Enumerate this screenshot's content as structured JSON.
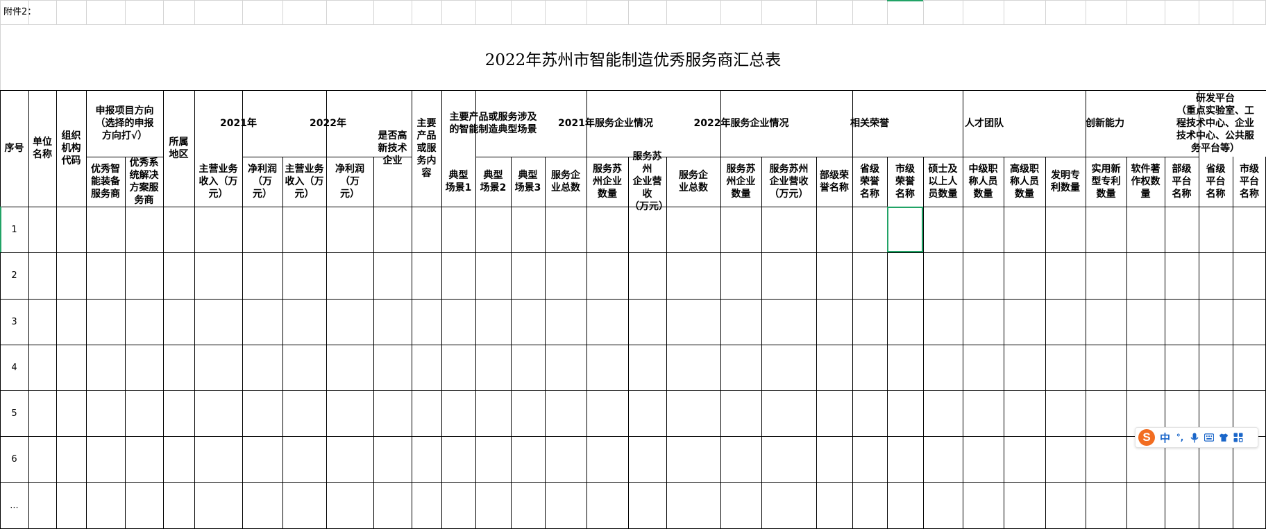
{
  "sheet": {
    "attachment_label": "附件2：",
    "title": "2022年苏州市智能制造优秀服务商汇总表"
  },
  "headers": {
    "seq": "序号",
    "unit_name": "单位\n名称",
    "org_code": "组织\n机构\n代码",
    "direction_group": "申报项目方向\n（选择的申报\n方向打√）",
    "direction_equipment": "优秀智\n能装备\n服务商",
    "direction_solution": "优秀系\n统解决\n方案服\n务商",
    "region": "所属\n地区",
    "y2021_group": "2021年",
    "y2021_revenue": "主营业务\n收入（万\n元）",
    "y2021_profit": "净利润\n（万\n元）",
    "y2022_group": "2022年",
    "y2022_revenue": "主营业务\n收入（万\n元）",
    "y2022_profit": "净利润\n（万\n元）",
    "hightech": "是否高\n新技术\n企业",
    "products": "主要\n产品\n或服\n务内\n容",
    "scenario_group": "主要产品或服务涉及\n的智能制造典型场景",
    "scenario_1": "典型\n场景1",
    "scenario_2": "典型\n场景2",
    "scenario_3": "典型\n场景3",
    "svc2021_group": "2021年服务企业情况",
    "svc2021_total": "服务企\n业总数",
    "svc2021_suzhou_count": "服务苏\n州企业\n数量",
    "svc2021_suzhou_revenue": "服务苏州\n企业营收\n（万元）",
    "svc2022_group": "2022年服务企业情况",
    "svc2022_total": "服务企\n业总数",
    "svc2022_suzhou_count": "服务苏\n州企业\n数量",
    "svc2022_suzhou_revenue": "服务苏州\n企业营收\n（万元）",
    "honors_group": "相关荣誉",
    "honor_ministry": "部级荣\n誉名称",
    "honor_province": "省级\n荣誉\n名称",
    "honor_city": "市级\n荣誉\n名称",
    "talent_group": "人才团队",
    "talent_masters": "硕士及\n以上人\n员数量",
    "talent_mid": "中级职\n称人员\n数量",
    "talent_senior": "高级职\n称人员\n数量",
    "innovation_group": "创新能力",
    "innov_invention": "发明专\n利数量",
    "innov_utility": "实用新\n型专利\n数量",
    "innov_software": "软件著\n作权数\n量",
    "rnd_group": "研发平台\n（重点实验室、工\n程技术中心、企业\n技术中心、公共服\n务平台等）",
    "rnd_ministry": "部级\n平台\n名称",
    "rnd_province": "省级\n平台\n名称",
    "rnd_city": "市级\n平台\n名称"
  },
  "rows": [
    "1",
    "2",
    "3",
    "4",
    "5",
    "6",
    "..."
  ],
  "ime": {
    "logo": "S",
    "mode": "中",
    "punct": "°,",
    "icons": [
      "microphone-icon",
      "keyboard-icon",
      "skin-icon",
      "toolbox-icon"
    ]
  }
}
